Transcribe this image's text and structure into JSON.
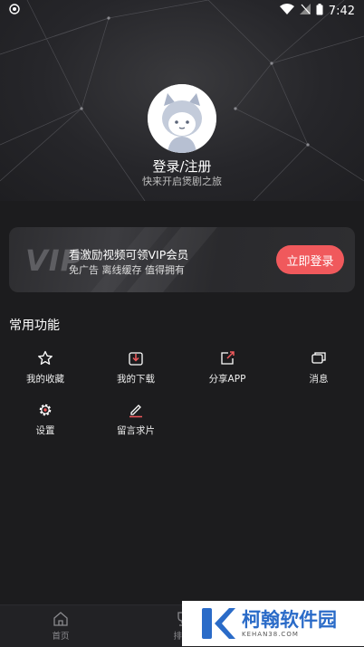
{
  "status_bar": {
    "time": "7:42"
  },
  "profile": {
    "login_title": "登录/注册",
    "login_subtitle": "快来开启煲剧之旅"
  },
  "vip_card": {
    "logo_text": "VIP",
    "title": "看激励视频可领VIP会员",
    "subtitle": "免广告 离线缓存 值得拥有",
    "button_label": "立即登录",
    "accent_color": "#f0595c"
  },
  "functions": {
    "section_title": "常用功能",
    "items": [
      {
        "label": "我的收藏",
        "icon": "star-icon"
      },
      {
        "label": "我的下载",
        "icon": "download-icon"
      },
      {
        "label": "分享APP",
        "icon": "share-icon"
      },
      {
        "label": "消息",
        "icon": "message-icon"
      },
      {
        "label": "设置",
        "icon": "gear-icon"
      },
      {
        "label": "留言求片",
        "icon": "edit-icon"
      }
    ]
  },
  "bottom_nav": {
    "items": [
      {
        "label": "首页",
        "icon": "home-icon"
      },
      {
        "label": "排行",
        "icon": "trophy-icon"
      }
    ]
  },
  "watermark": {
    "name": "柯翰软件园",
    "url": "KEHAN38.COM"
  }
}
